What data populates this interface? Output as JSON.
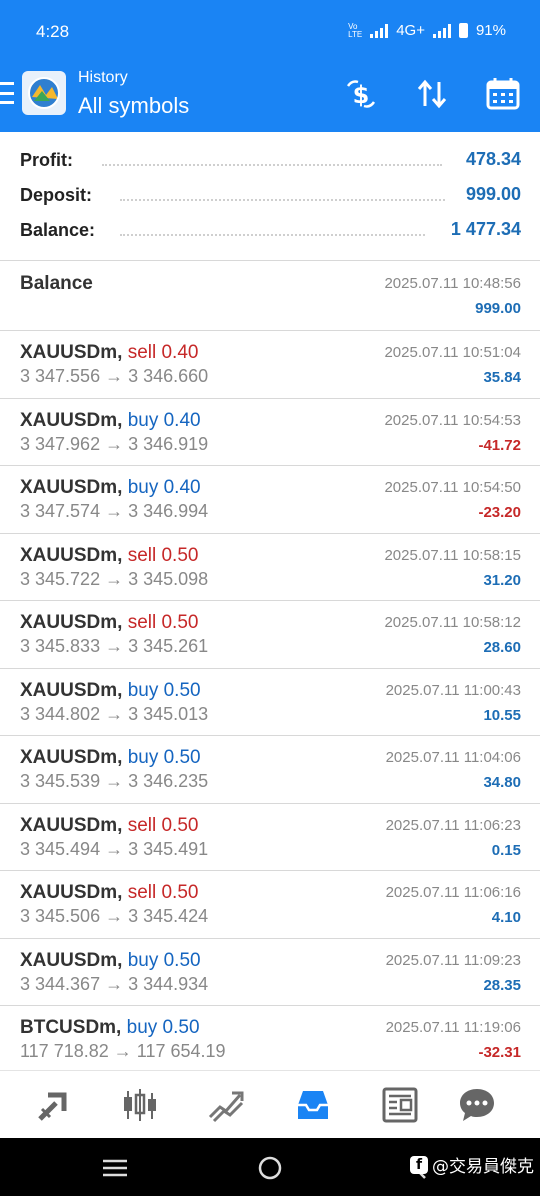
{
  "status_bar": {
    "time": "4:28",
    "network": "4G+",
    "battery": "91%"
  },
  "header": {
    "subtitle": "History",
    "title": "All symbols"
  },
  "summary": {
    "profit_label": "Profit:",
    "profit_value": "478.34",
    "deposit_label": "Deposit:",
    "deposit_value": "999.00",
    "balance_label": "Balance:",
    "balance_value": "1 477.34"
  },
  "balance_entry": {
    "label": "Balance",
    "date": "2025.07.11 10:48:56",
    "amount": "999.00"
  },
  "deals": [
    {
      "symbol": "XAUUSDm,",
      "side": "sell",
      "volume": "0.40",
      "open": "3 347.556",
      "close": "3 346.660",
      "date": "2025.07.11 10:51:04",
      "profit": "35.84",
      "profit_sign": "pos"
    },
    {
      "symbol": "XAUUSDm,",
      "side": "buy",
      "volume": "0.40",
      "open": "3 347.962",
      "close": "3 346.919",
      "date": "2025.07.11 10:54:53",
      "profit": "-41.72",
      "profit_sign": "neg"
    },
    {
      "symbol": "XAUUSDm,",
      "side": "buy",
      "volume": "0.40",
      "open": "3 347.574",
      "close": "3 346.994",
      "date": "2025.07.11 10:54:50",
      "profit": "-23.20",
      "profit_sign": "neg"
    },
    {
      "symbol": "XAUUSDm,",
      "side": "sell",
      "volume": "0.50",
      "open": "3 345.722",
      "close": "3 345.098",
      "date": "2025.07.11 10:58:15",
      "profit": "31.20",
      "profit_sign": "pos"
    },
    {
      "symbol": "XAUUSDm,",
      "side": "sell",
      "volume": "0.50",
      "open": "3 345.833",
      "close": "3 345.261",
      "date": "2025.07.11 10:58:12",
      "profit": "28.60",
      "profit_sign": "pos"
    },
    {
      "symbol": "XAUUSDm,",
      "side": "buy",
      "volume": "0.50",
      "open": "3 344.802",
      "close": "3 345.013",
      "date": "2025.07.11 11:00:43",
      "profit": "10.55",
      "profit_sign": "pos"
    },
    {
      "symbol": "XAUUSDm,",
      "side": "buy",
      "volume": "0.50",
      "open": "3 345.539",
      "close": "3 346.235",
      "date": "2025.07.11 11:04:06",
      "profit": "34.80",
      "profit_sign": "pos"
    },
    {
      "symbol": "XAUUSDm,",
      "side": "sell",
      "volume": "0.50",
      "open": "3 345.494",
      "close": "3 345.491",
      "date": "2025.07.11 11:06:23",
      "profit": "0.15",
      "profit_sign": "pos"
    },
    {
      "symbol": "XAUUSDm,",
      "side": "sell",
      "volume": "0.50",
      "open": "3 345.506",
      "close": "3 345.424",
      "date": "2025.07.11 11:06:16",
      "profit": "4.10",
      "profit_sign": "pos"
    },
    {
      "symbol": "XAUUSDm,",
      "side": "buy",
      "volume": "0.50",
      "open": "3 344.367",
      "close": "3 344.934",
      "date": "2025.07.11 11:09:23",
      "profit": "28.35",
      "profit_sign": "pos"
    },
    {
      "symbol": "BTCUSDm,",
      "side": "buy",
      "volume": "0.50",
      "open": "117 718.82",
      "close": "117 654.19",
      "date": "2025.07.11 11:19:06",
      "profit": "-32.31",
      "profit_sign": "neg"
    }
  ],
  "arrow": "→",
  "bottom_nav": [
    "quotes-icon",
    "chart-icon",
    "trade-icon",
    "history-icon",
    "news-icon",
    "chat-icon"
  ],
  "watermark": "@交易員傑克",
  "colors": {
    "accent": "#1a84f4",
    "positive": "#1d6db5",
    "negative": "#c62828"
  }
}
